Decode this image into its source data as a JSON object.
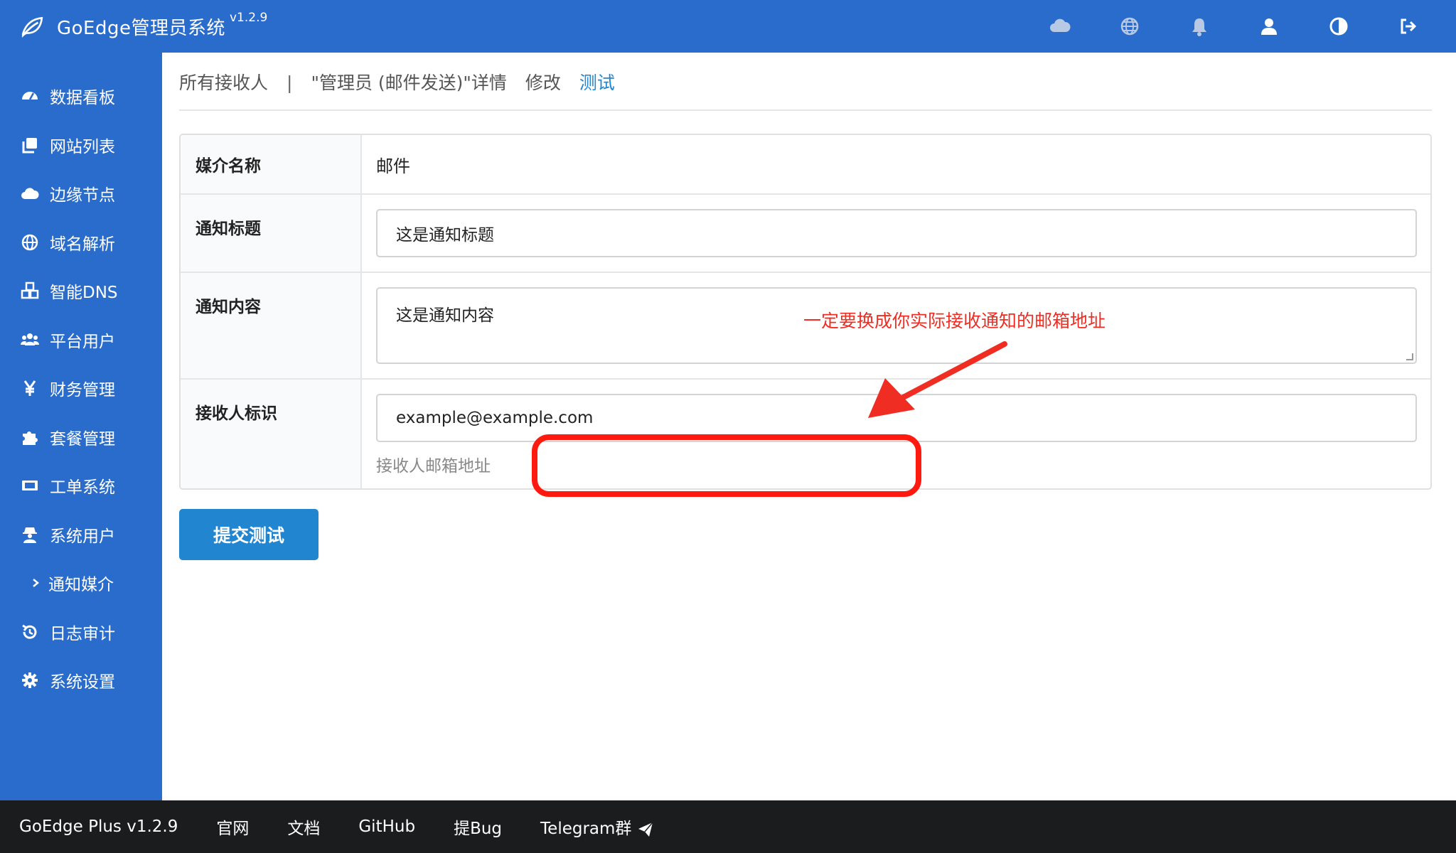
{
  "brand": {
    "title": "GoEdge管理员系统",
    "version": "v1.2.9"
  },
  "sidebar": {
    "items": [
      {
        "label": "数据看板",
        "icon": "dashboard-icon"
      },
      {
        "label": "网站列表",
        "icon": "copy-icon"
      },
      {
        "label": "边缘节点",
        "icon": "cloud-icon"
      },
      {
        "label": "域名解析",
        "icon": "globe-icon"
      },
      {
        "label": "智能DNS",
        "icon": "cubes-icon"
      },
      {
        "label": "平台用户",
        "icon": "users-icon"
      },
      {
        "label": "财务管理",
        "icon": "yen-icon"
      },
      {
        "label": "套餐管理",
        "icon": "puzzle-icon"
      },
      {
        "label": "工单系统",
        "icon": "ticket-icon"
      },
      {
        "label": "系统用户",
        "icon": "user-secret-icon"
      },
      {
        "label": "通知媒介",
        "icon": "chevron-right-icon"
      },
      {
        "label": "日志审计",
        "icon": "history-icon"
      },
      {
        "label": "系统设置",
        "icon": "gear-icon"
      }
    ]
  },
  "tabs": {
    "all": "所有接收人",
    "sep": "|",
    "detail": "\"管理员 (邮件发送)\"详情",
    "edit": "修改",
    "test": "测试"
  },
  "form": {
    "media_label": "媒介名称",
    "media_value": "邮件",
    "subject_label": "通知标题",
    "subject_value": "这是通知标题",
    "body_label": "通知内容",
    "body_value": "这是通知内容",
    "receiver_label": "接收人标识",
    "receiver_value": "example@example.com",
    "receiver_hint": "接收人邮箱地址"
  },
  "submit_label": "提交测试",
  "annotation": "一定要换成你实际接收通知的邮箱地址",
  "footer": {
    "product": "GoEdge Plus v1.2.9",
    "official": "官网",
    "docs": "文档",
    "github": "GitHub",
    "bug": "提Bug",
    "telegram": "Telegram群"
  },
  "colors": {
    "primary": "#2a6ccb",
    "button": "#2185d0",
    "annotation": "#ff1a10",
    "footer": "#1b1c1d"
  }
}
